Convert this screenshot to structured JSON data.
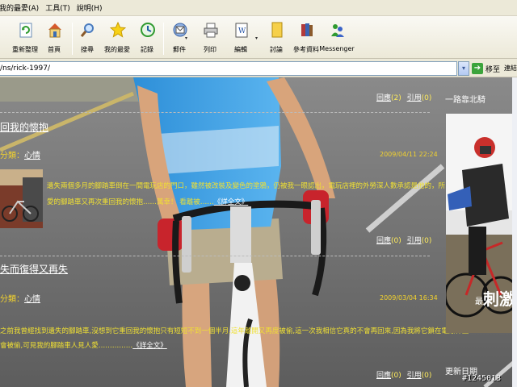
{
  "menu": {
    "favorites": "我的最愛(A)",
    "tools": "工具(T)",
    "help": "說明(H)"
  },
  "toolbar": {
    "refresh": "重新整理",
    "home": "首頁",
    "search": "搜尋",
    "favorites": "我的最愛",
    "history": "記錄",
    "mail": "郵件",
    "print": "列印",
    "edit": "編輯",
    "discuss": "討論",
    "research": "參考資料",
    "messenger": "Messenger"
  },
  "address": {
    "url": "/ns/rick-1997/",
    "go": "移至",
    "links": "連結"
  },
  "post1": {
    "counts_line": "回應 (2)  引用 (0)",
    "reply_label": "回應",
    "reply_count": "(2)",
    "trackback_label": "引用",
    "trackback_count": "(0)",
    "title": "回我的懷抱",
    "category_prefix": "分類：",
    "category": "心情",
    "date": "2009/04/11 22:24",
    "body_line1": "遺失兩個多月的腳踏車倒在一間電玩店的門口，雖然被改裝及變色的塗鴉，仍被我一眼認出，電玩店裡的外勞深人數承認是他的，所以也",
    "body_line2": "愛的腳踏車又再次重回我的懷抱……萬幸！ 看離被……",
    "more": "《詳全文》",
    "footer_reply": "回應",
    "footer_reply_count": "(0)",
    "footer_trackback": "引用",
    "footer_trackback_count": "(0)"
  },
  "post2": {
    "title": "失而復得又再失",
    "category_prefix": "分類：",
    "category": "心情",
    "date": "2009/03/04 16:34",
    "body_line1": "之前我曾經找到遺失的腳踏車,沒想到它重回我的懷抱只有短短不到一個半月,這年離開又再度被偷,這一次我相信它真的不會再回來,因為我將它鎖在電線桿上",
    "body_line2": "會被偷,可見我的腳踏車人見人愛……………",
    "more": "《詳全文》",
    "footer_reply": "回應",
    "footer_reply_count": "(0)",
    "footer_trackback": "引用",
    "footer_trackback_count": "(0)"
  },
  "sidebar": {
    "heading": "一路靠北騎",
    "img_caption_small": "最",
    "img_caption_big": "刺激",
    "updates": "更新日期"
  },
  "watermark": "#1245013",
  "colors": {
    "accent_yellow": "#ffec5c",
    "body_yellow": "#f0e033",
    "page_bg": "#5c5c5c"
  }
}
